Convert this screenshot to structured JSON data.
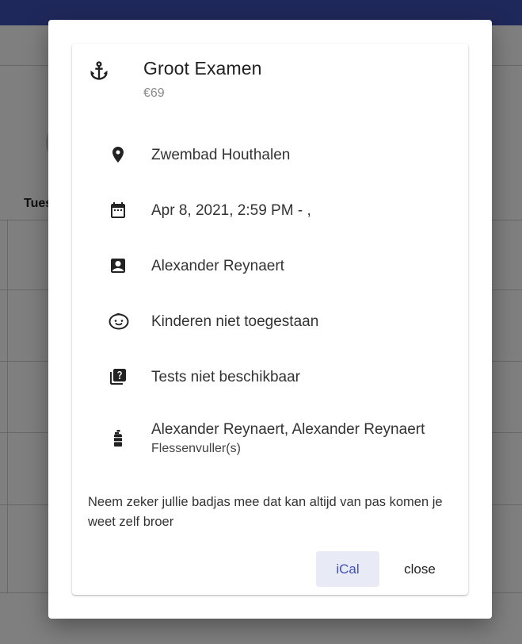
{
  "background": {
    "day_header": "Tues"
  },
  "event": {
    "title": "Groot Examen",
    "price": "€69",
    "header_icon": "anchor-icon",
    "details": [
      {
        "icon": "location-pin-icon",
        "text": "Zwembad Houthalen"
      },
      {
        "icon": "calendar-icon",
        "text": "Apr 8, 2021, 2:59 PM - ,"
      },
      {
        "icon": "person-badge-icon",
        "text": "Alexander Reynaert"
      },
      {
        "icon": "child-face-icon",
        "text": "Kinderen niet toegestaan"
      },
      {
        "icon": "quiz-icon",
        "text": "Tests niet beschikbaar"
      },
      {
        "icon": "gas-cylinder-icon",
        "text": "Alexander Reynaert, Alexander Reynaert",
        "subtext": "Flessenvuller(s)"
      }
    ],
    "note": "Neem zeker jullie badjas mee dat kan altijd van pas komen je weet zelf broer"
  },
  "actions": {
    "ical_label": "iCal",
    "close_label": "close"
  },
  "colors": {
    "accent": "#3f51b5",
    "accent_light": "#e8eaf6"
  }
}
